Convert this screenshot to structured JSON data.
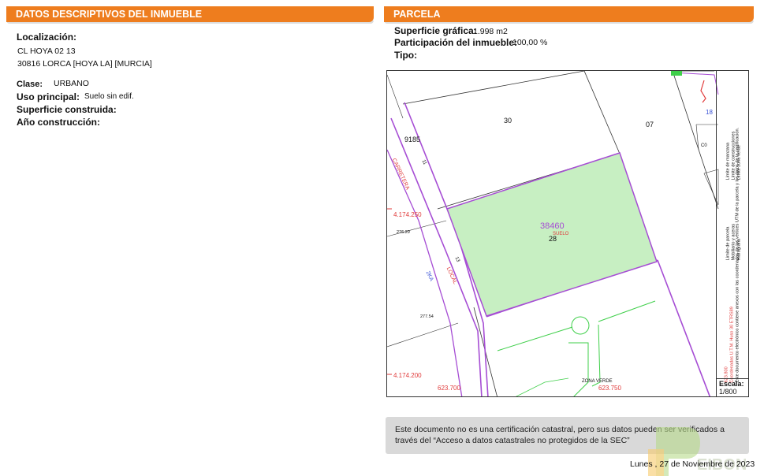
{
  "left_panel": {
    "title": "DATOS DESCRIPTIVOS DEL INMUEBLE",
    "localizacion_label": "Localización:",
    "address_line1": "CL HOYA 02 13",
    "address_line2": "30816 LORCA [HOYA LA] [MURCIA]",
    "clase_label": "Clase:",
    "clase_value": "URBANO",
    "uso_label": "Uso principal:",
    "uso_value": "Suelo sin edif.",
    "superficie_label": "Superficie construida:",
    "ano_label": "Año construcción:"
  },
  "right_panel": {
    "title": "PARCELA",
    "superficie_label": "Superficie gráfica:",
    "superficie_value": "1.998 m2",
    "participacion_label": "Participación del inmueble:",
    "participacion_value": "100,00 %",
    "tipo_label": "Tipo:"
  },
  "map": {
    "parcel_ref": "38460",
    "suelo": "SUELO",
    "parcel_28": "28",
    "n30": "30",
    "n07": "07",
    "n9185": "9185",
    "n18": "18",
    "n13": "13",
    "n11": "11",
    "c0": "C0",
    "carretera": "CARRETERA",
    "local": "LOCAL",
    "via": "2KA",
    "utm_y1": "4.174.250",
    "utm_y2": "4.174.200",
    "utm_x1": "623.700",
    "utm_x2": "623.750",
    "elev1": "276.29",
    "elev2": "277.54",
    "zona_verde": "ZONA VERDE",
    "legend_parcela": "Límite de parcela",
    "legend_manzana": "Límite de manzana",
    "legend_hidrografia": "Hidrografía",
    "legend_construcciones": "Límite de construcciones",
    "legend_mobiliario": "Mobiliario y aceras",
    "legend_zona_verde": "Límite zona verde",
    "legend_coords": "Coordenadas U.T.M. Huso 30 ETRS89",
    "legend_note1": "Este documento electrónico contiene anexos con las coordenadas de los vértices UTM de la parcela y los datos de la certificación.",
    "legend_coord_x": "623.800",
    "scale_label": "Escala:",
    "scale_value": "1/800"
  },
  "notice": {
    "text": "Este documento no es una certificación catastral, pero sus datos pueden ser verificados a través del “Acceso a datos catastrales no protegidos de la SEC”"
  },
  "date": "Lunes , 27 de Noviembre de 2023",
  "colors": {
    "header_orange": "#ee7d1e",
    "parcel_fill": "#c7efc2",
    "parcel_border": "#a64dd4",
    "road_line": "#a64dd4",
    "green_line": "#3fcf4a",
    "utm_red": "#e03a3a"
  }
}
